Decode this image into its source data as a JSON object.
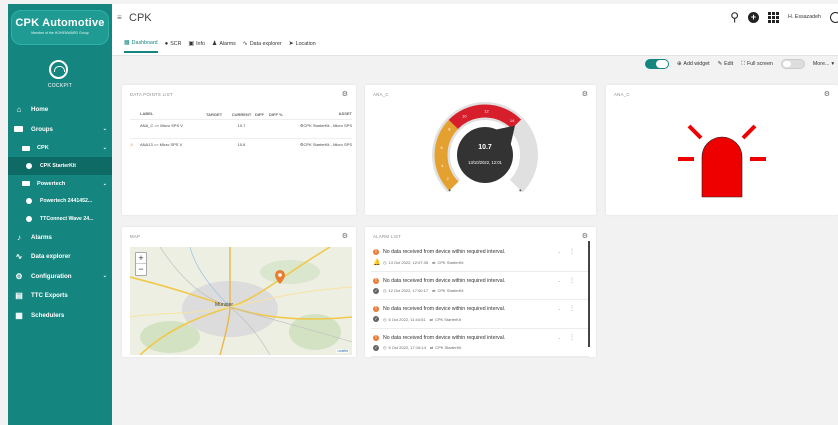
{
  "brand": {
    "title": "CPK Automotive",
    "subtitle": "Member of the HOHENWARD Group"
  },
  "cockpit": {
    "label": "COCKPIT"
  },
  "sidebar": {
    "items": [
      {
        "label": "Home",
        "icon": "home-icon",
        "glyph": "⌂"
      },
      {
        "label": "Groups",
        "icon": "folder-icon"
      },
      {
        "label": "CPK",
        "icon": "folder-icon"
      },
      {
        "label": "CPK StarterKit",
        "icon": "device-icon"
      },
      {
        "label": "Powertech",
        "icon": "folder-icon"
      },
      {
        "label": "Powertech 2441452...",
        "icon": "device-icon"
      },
      {
        "label": "TTConnect Wave 24...",
        "icon": "device-icon"
      },
      {
        "label": "Alarms",
        "icon": "bell-icon",
        "glyph": "🔔"
      },
      {
        "label": "Data explorer",
        "icon": "data-explorer-icon",
        "glyph": "⌁"
      },
      {
        "label": "Configuration",
        "icon": "configuration-icon",
        "glyph": "⚙"
      },
      {
        "label": "TTC Exports",
        "icon": "exports-icon",
        "glyph": "⇪"
      },
      {
        "label": "Schedulers",
        "icon": "calendar-icon",
        "glyph": "▦"
      }
    ]
  },
  "header": {
    "title": "CPK",
    "user": "H. Essazadeh",
    "tabs": [
      {
        "label": "Dashboard",
        "glyph": "▦"
      },
      {
        "label": "SCR",
        "glyph": "●"
      },
      {
        "label": "Info",
        "glyph": "▣"
      },
      {
        "label": "Alarms",
        "glyph": "♟"
      },
      {
        "label": "Data explorer",
        "glyph": "∿"
      },
      {
        "label": "Location",
        "glyph": "➤"
      }
    ]
  },
  "toolbar": {
    "add_widget": "Add widget",
    "edit": "Edit",
    "full_screen": "Full screen",
    "more": "More..."
  },
  "widgets": {
    "data_points": {
      "title": "DATA POINTS LIST",
      "columns": {
        "label": "LABEL",
        "target": "TARGET",
        "current": "CURRENT",
        "diff": "DIFF",
        "diff_pct": "DIFF %",
        "asset": "ASSET"
      },
      "rows": [
        {
          "label": "ANA_C => Micro SPS V",
          "target": "",
          "current": "10.7",
          "diff": "",
          "diff_pct": "",
          "asset": "CPK StarterKit - Micro SPS"
        },
        {
          "label": "ANA13 => Micro SPS V",
          "target": "",
          "current": "10.6",
          "diff": "",
          "diff_pct": "",
          "asset": "CPK StarterKit - Micro SPS"
        }
      ]
    },
    "gauge": {
      "title": "ANA_C",
      "value": "10.7",
      "value_num": 10.7,
      "min": 0,
      "max": 16,
      "timestamp": "13/10/2022, 12:01",
      "colors": {
        "low": "#e5a130",
        "high": "#d71f2b",
        "track": "#e0e0e0",
        "center": "#333333"
      },
      "ticks": [
        {
          "label": "2",
          "angle": 238
        },
        {
          "label": "4",
          "angle": 256
        },
        {
          "label": "6",
          "angle": 280
        },
        {
          "label": "8",
          "angle": 306
        },
        {
          "label": "10",
          "angle": 332
        },
        {
          "label": "12",
          "angle": 362
        },
        {
          "label": "14",
          "angle": 398
        }
      ]
    },
    "indicator": {
      "title": "ANA_C",
      "color": "#ee0000"
    },
    "map": {
      "title": "MAP",
      "city": "Münster",
      "credit": "Leaflet"
    },
    "alarms": {
      "title": "ALARM LIST",
      "items": [
        {
          "message": "No data received from device within required interval.",
          "time": "13 Oct 2022, 12:07:35",
          "device": "CPK StarterKit",
          "status": "bell"
        },
        {
          "message": "No data received from device within required interval.",
          "time": "12 Oct 2022, 17:00:17",
          "device": "CPK StarterKit",
          "status": "ack"
        },
        {
          "message": "No data received from device within required interval.",
          "time": "6 Oct 2022, 11:44:51",
          "device": "CPK StarterKit",
          "status": "ack"
        },
        {
          "message": "No data received from device within required interval.",
          "time": "5 Oct 2022, 17:16:14",
          "device": "CPK StarterKit",
          "status": "ack"
        }
      ]
    }
  }
}
